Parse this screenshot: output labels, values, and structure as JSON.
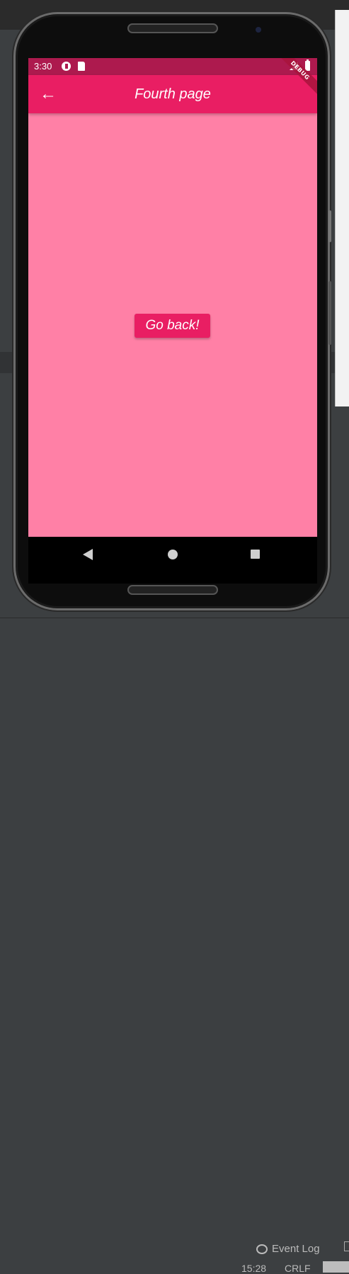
{
  "ide": {
    "event_log_label": "Event Log",
    "cursor_position": "15:28",
    "line_separator": "CRLF"
  },
  "device": {
    "status_bar": {
      "time": "3:30"
    },
    "debug_banner": "DEBUG",
    "app_bar": {
      "title": "Fourth page",
      "back_icon": "←"
    },
    "body": {
      "button_label": "Go back!"
    },
    "nav_bar": {
      "back_icon": "triangle-back",
      "home_icon": "circle-home",
      "recents_icon": "square-recents"
    }
  },
  "colors": {
    "status_bar": "#ad1a4e",
    "app_bar": "#e91e63",
    "body_background": "#ff80a6",
    "button": "#e91e63"
  }
}
